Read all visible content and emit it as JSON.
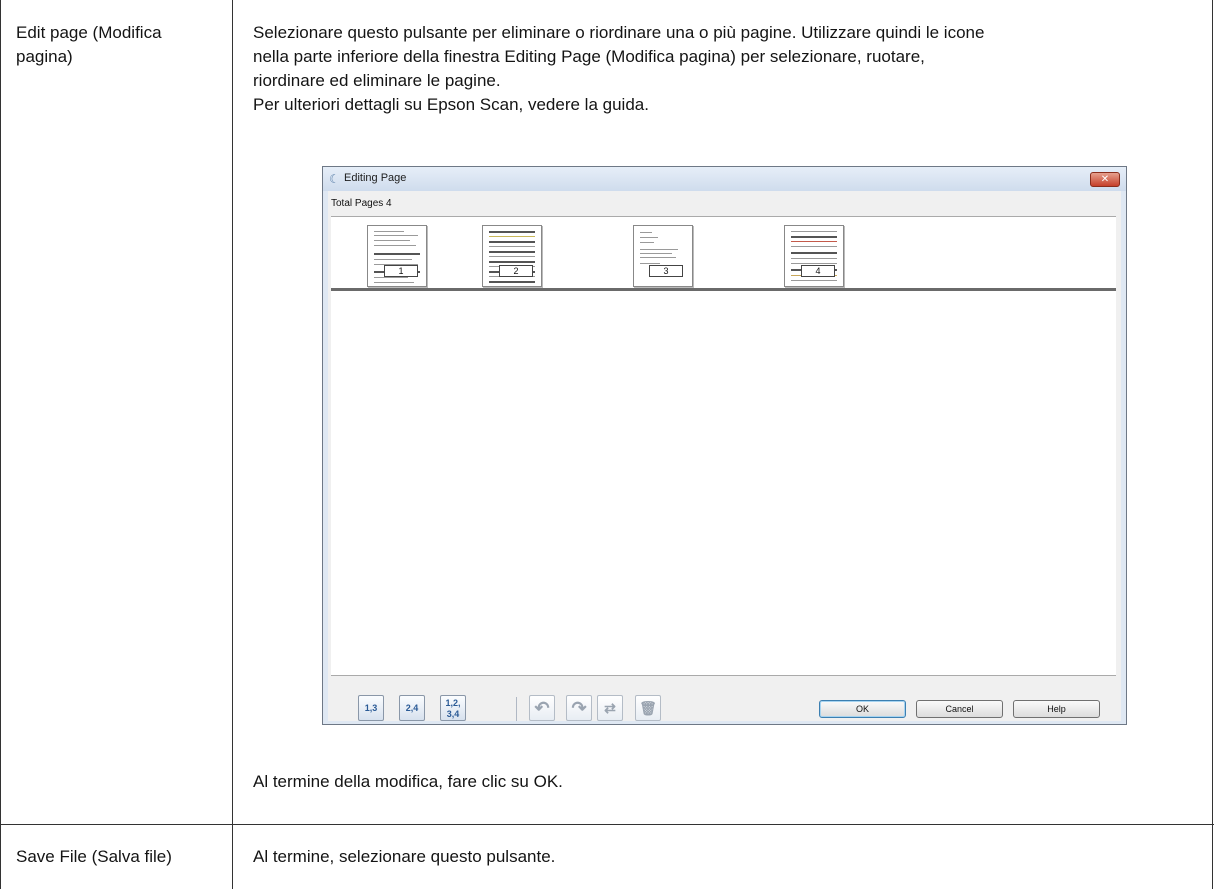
{
  "rows": [
    {
      "term": "Edit page (Modifica pagina)",
      "description": [
        "Selezionare questo pulsante per eliminare o riordinare una o più pagine. Utilizzare quindi le icone",
        "nella parte inferiore della finestra Editing Page (Modifica pagina) per selezionare, ruotare,",
        "riordinare ed eliminare le pagine.",
        "Per ulteriori dettagli su Epson Scan, vedere la guida."
      ],
      "after_text": "Al termine della modifica, fare clic su OK."
    },
    {
      "term": "Save File (Salva file)",
      "description": "Al termine, selezionare questo pulsante."
    }
  ],
  "dialog": {
    "title": "Editing Page",
    "close_label": "✕",
    "total_pages_label": "Total Pages 4",
    "pages": [
      "1",
      "2",
      "3",
      "4"
    ],
    "toolbar_icons": [
      "select-odd-pages",
      "select-even-pages",
      "select-all-pages",
      "rotate-left",
      "rotate-right",
      "reorder-pages",
      "delete-page"
    ],
    "buttons": {
      "ok": "OK",
      "cancel": "Cancel",
      "help": "Help"
    }
  }
}
